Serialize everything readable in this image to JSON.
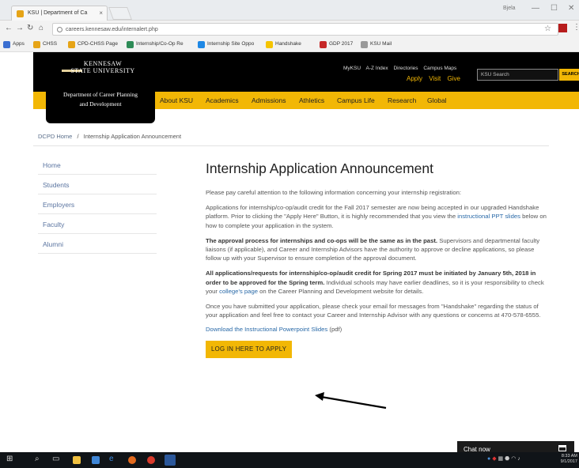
{
  "browser": {
    "tab_title": "KSU | Department of Ca",
    "tab_close": "×",
    "profile": "Bjela",
    "url": "careers.kennesaw.edu/internalert.php",
    "bookmarks": [
      {
        "label": "Apps",
        "color": "#3b6fd1"
      },
      {
        "label": "CHSS",
        "color": "#e6a417"
      },
      {
        "label": "CPD-CHSS Page",
        "color": "#e6a417"
      },
      {
        "label": "Internship/Co-Op Re",
        "color": "#2e8b57"
      },
      {
        "label": "Internship Site Oppo",
        "color": "#1e88e5"
      },
      {
        "label": "Handshake",
        "color": "#f5c400"
      },
      {
        "label": "GDP 2017",
        "color": "#c62828"
      },
      {
        "label": "KSU Mail",
        "color": "#999999"
      }
    ]
  },
  "header": {
    "university_line1": "KENNESAW",
    "university_line2": "STATE UNIVERSITY",
    "department_line1": "Department of Career Planning",
    "department_line2": "and Development",
    "top_links": [
      "MyKSU",
      "A-Z Index",
      "Directories",
      "Campus Maps"
    ],
    "action_links": [
      "Apply",
      "Visit",
      "Give"
    ],
    "search_placeholder": "KSU Search",
    "search_button": "SEARCH"
  },
  "nav": [
    "About KSU",
    "Academics",
    "Admissions",
    "Athletics",
    "Campus Life",
    "Research",
    "Global"
  ],
  "breadcrumb": {
    "home": "DCPD Home",
    "separator": "/",
    "current": "Internship Application Announcement"
  },
  "sidebar": [
    "Home",
    "Students",
    "Employers",
    "Faculty",
    "Alumni"
  ],
  "main": {
    "title": "Internship Application Announcement",
    "p1": "Please pay careful attention to the following information concerning your internship registration:",
    "p2_a": "Applications for internship/co-op/audit credit for the Fall 2017 semester are now being accepted in our upgraded Handshake platform.  Prior to clicking the \"Apply Here\" Button, it is highly recommended that you view the ",
    "p2_link": "instructional PPT slides",
    "p2_b": " below on how to complete your application in the system.",
    "p3_bold": "The approval process for internships and co-ops will be the same as in the past.",
    "p3_rest": "  Supervisors and departmental faculty liaisons (if applicable), and Career and Internship Advisors have the authority to approve or decline applications, so please follow up with your Supervisor to ensure completion of the approval document.",
    "p4_bold": "All applications/requests for internship/co-op/audit credit for Spring 2017 must be initiated by January 5th, 2018 in order to be approved for the Spring term.",
    "p4_a": " Individual schools may have earlier deadlines, so it is your responsibility to check your ",
    "p4_link": "college's page",
    "p4_b": " on the Career Planning and Development website for details.",
    "p5": "Once you have submitted your application, please check your email for messages from \"Handshake\" regarding the status of your application and feel free to contact your Career and Internship Advisor with any questions or concerns at 470-578-6555.",
    "download_link": "Download the Instructional Powerpoint Slides",
    "download_suffix": " (pdf)",
    "apply_button": "LOG IN HERE TO APPLY"
  },
  "chat": {
    "label": "Chat now"
  },
  "taskbar": {
    "clock_time": "8:33 AM",
    "clock_date": "9/1/2017"
  },
  "colors": {
    "ksu_gold": "#f2b705",
    "ksu_black": "#000000",
    "link_blue": "#2a6aa8"
  }
}
